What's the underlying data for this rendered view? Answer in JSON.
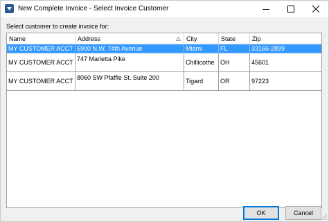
{
  "window": {
    "title": "New Complete Invoice - Select Invoice Customer"
  },
  "prompt": "Select customer to create invoice for:",
  "table": {
    "columns": [
      "Name",
      "Address",
      "City",
      "State",
      "Zip"
    ],
    "sorted_column": "Address",
    "rows": [
      {
        "name": "MY CUSTOMER ACCT",
        "address": "6900 N.W. 74th Avenue",
        "city": "Miami",
        "state": "FL",
        "zip": "33166-2899",
        "selected": true
      },
      {
        "name": "MY CUSTOMER ACCT",
        "address": "747 Marietta Pike",
        "city": "Chillicothe",
        "state": "OH",
        "zip": "45601",
        "selected": false
      },
      {
        "name": "MY CUSTOMER ACCT",
        "address": "8060 SW Pfaffle St. Suite 200",
        "city": "Tigard",
        "state": "OR",
        "zip": "97223",
        "selected": false
      }
    ]
  },
  "buttons": {
    "ok": "OK",
    "cancel": "Cancel"
  },
  "colors": {
    "selection": "#3399ff",
    "default_button_border": "#0078d7"
  },
  "icons": {
    "app": "app-icon",
    "minimize": "minimize-icon",
    "maximize": "maximize-icon",
    "close": "close-icon",
    "sort": "sort-ascending-icon",
    "resize": "resize-grip-icon"
  }
}
